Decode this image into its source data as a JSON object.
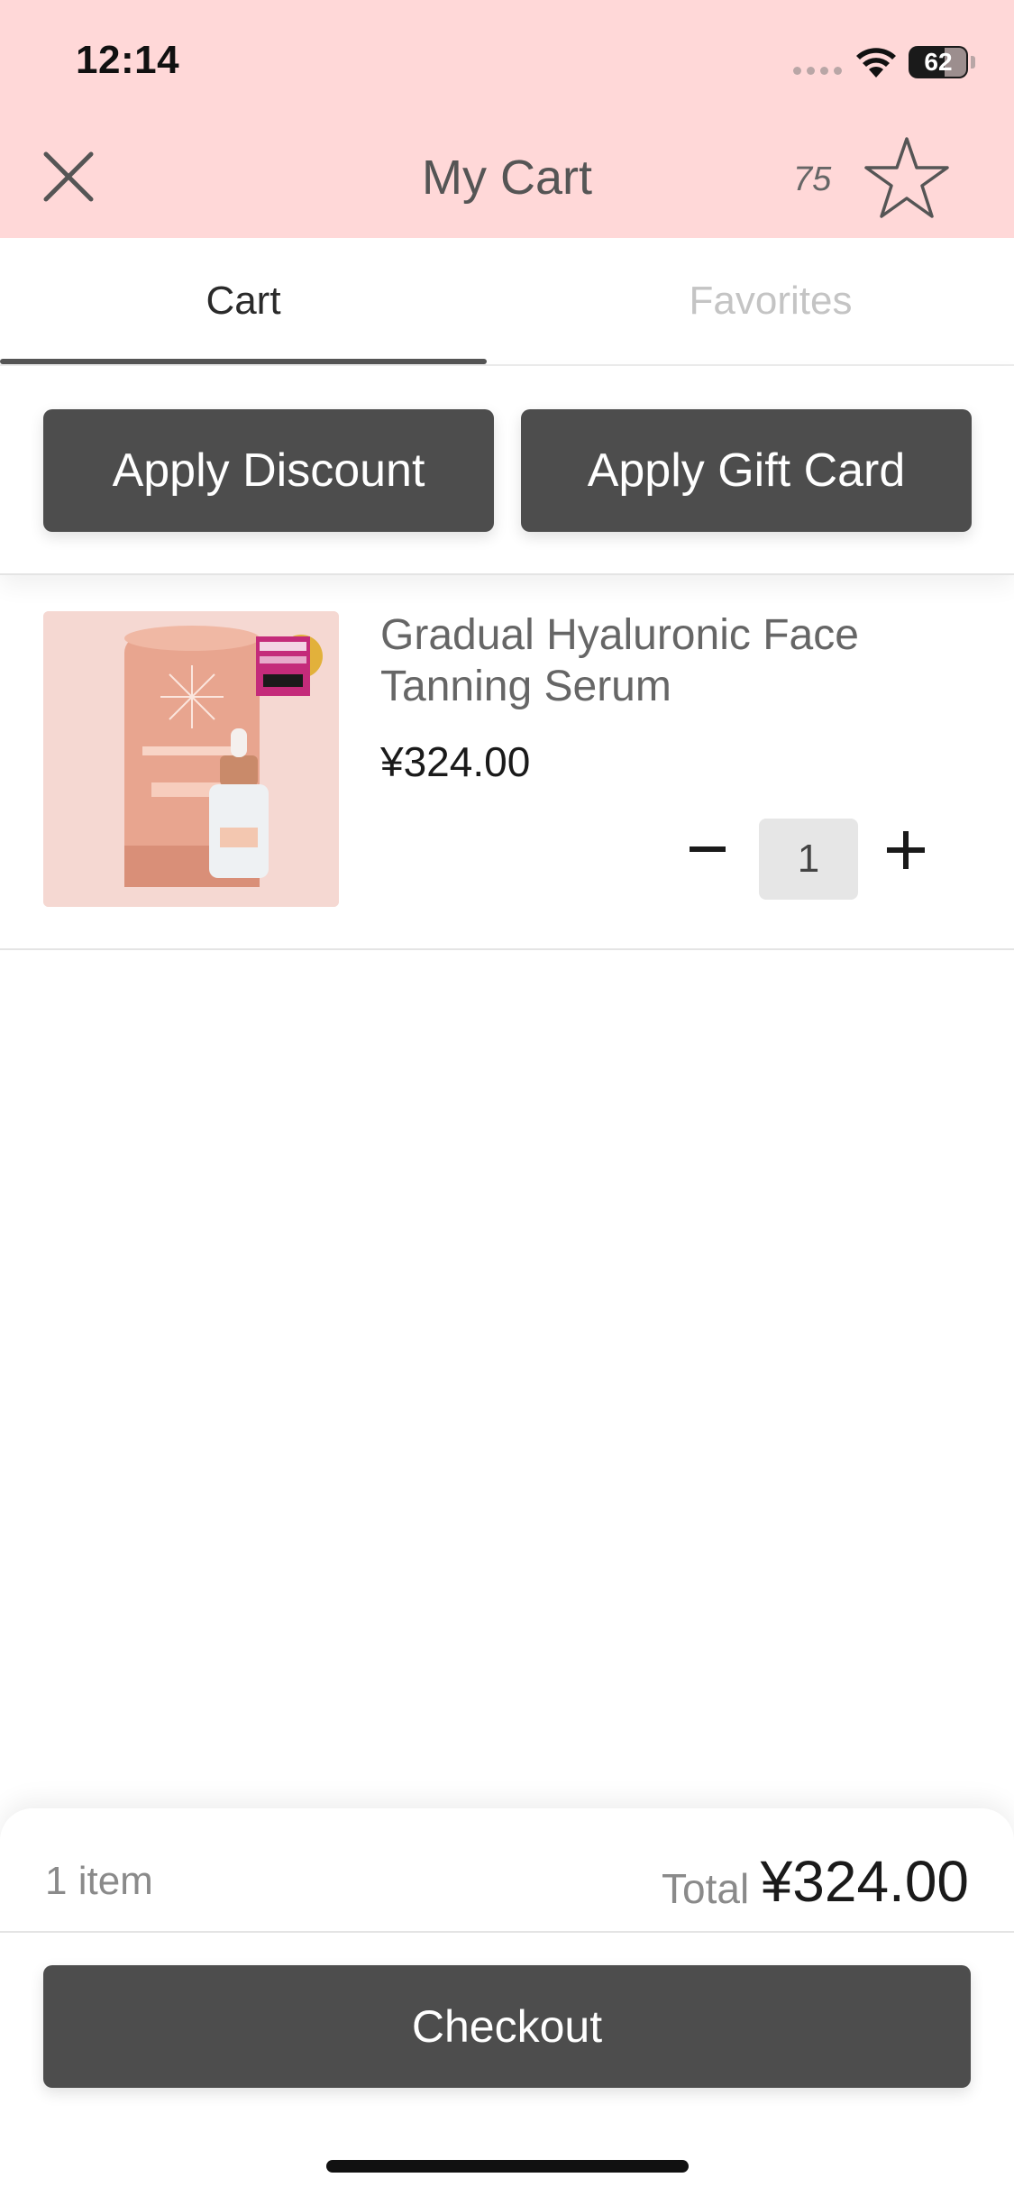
{
  "status_bar": {
    "time": "12:14",
    "battery": "62"
  },
  "header": {
    "title": "My Cart",
    "points": "75",
    "close_icon": "close-icon",
    "star_icon": "star-icon",
    "background_color": "#ffd8d8"
  },
  "tabs": [
    {
      "label": "Cart",
      "selected": true
    },
    {
      "label": "Favorites",
      "selected": false
    }
  ],
  "actions": {
    "discount_label": "Apply Discount",
    "gift_card_label": "Apply Gift Card"
  },
  "cart": {
    "items": [
      {
        "name": "Gradual Hyaluronic Face Tanning Serum",
        "price": "¥324.00",
        "quantity": "1",
        "image_icon": "product-image"
      }
    ]
  },
  "summary": {
    "item_count": "1 item",
    "total_label": "Total",
    "total_amount": "¥324.00",
    "checkout_label": "Checkout"
  },
  "colors": {
    "button": "#4d4d4d",
    "header_pink": "#ffd8d8",
    "product_bg": "#f5d8d2"
  }
}
